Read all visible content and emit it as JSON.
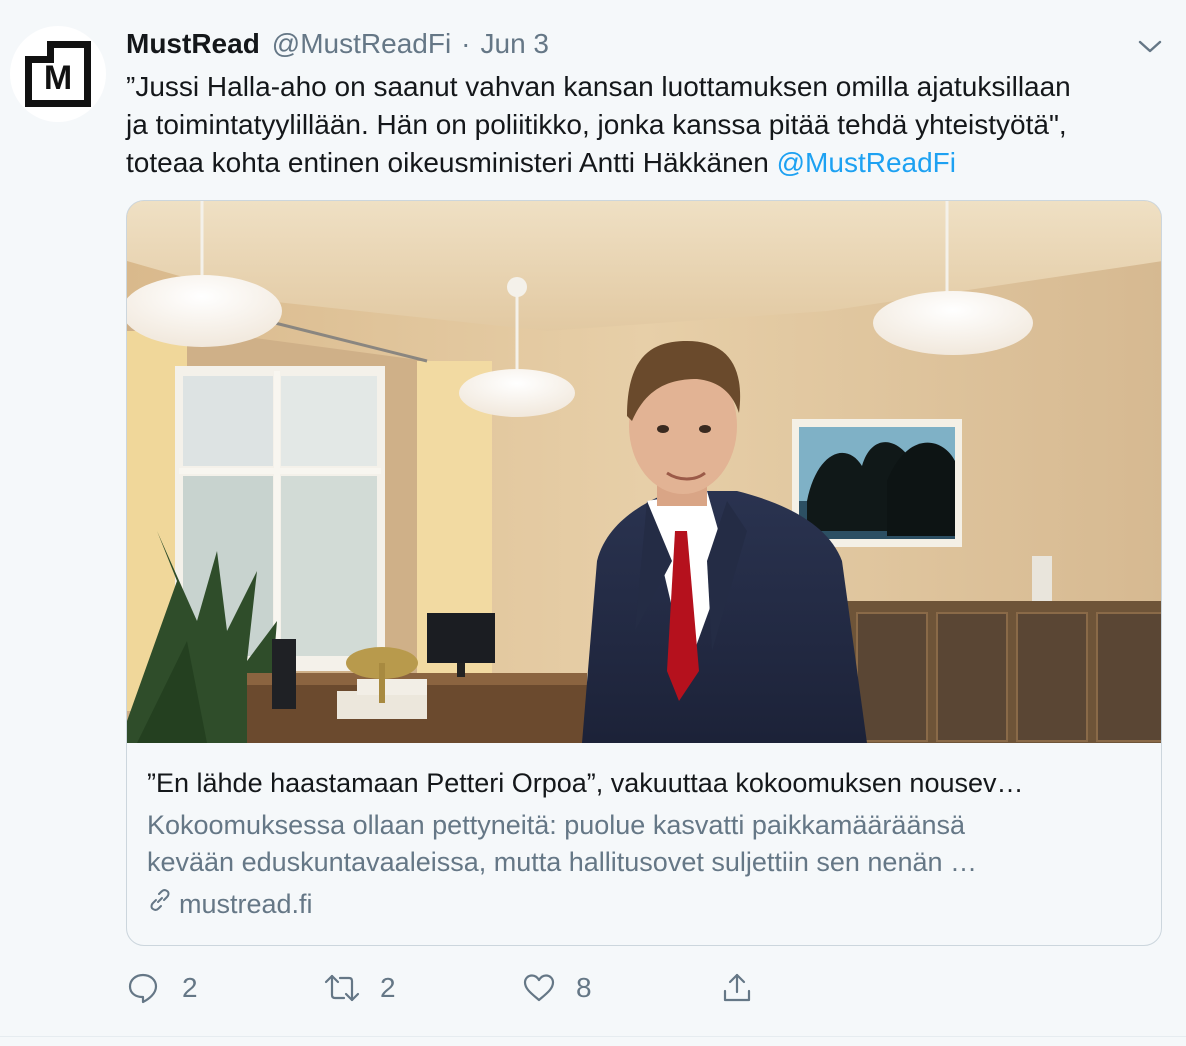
{
  "tweet": {
    "display_name": "MustRead",
    "handle": "@MustReadFi",
    "separator": "·",
    "date": "Jun 3",
    "avatar_letter": "M",
    "text_lines": [
      "”Jussi Halla-aho on saanut vahvan kansan luottamuksen omilla ajatuksillaan",
      "ja toimintatyylillään. Hän on poliitikko, jonka kanssa pitää tehdä yhteistyötä\",",
      "toteaa kohta entinen oikeusministeri Antti Häkkänen "
    ],
    "mention": "@MustReadFi"
  },
  "card": {
    "title": "”En lähde haastamaan Petteri Orpoa”, vakuuttaa kokoomuksen nousev…",
    "description_lines": [
      "Kokoomuksessa ollaan pettyneitä: puolue kasvatti paikkamääräänsä",
      "kevään eduskuntavaaleissa, mutta hallitusovet suljettiin sen nenän …"
    ],
    "domain": "mustread.fi"
  },
  "actions": {
    "reply_count": "2",
    "retweet_count": "2",
    "like_count": "8"
  },
  "colors": {
    "background": "#f5f8fa",
    "text": "#14171a",
    "secondary": "#657786",
    "link": "#1da1f2",
    "border": "#ccd6dd"
  },
  "icons": [
    "chevron-down-icon",
    "link-icon",
    "reply-icon",
    "retweet-icon",
    "like-icon",
    "share-icon"
  ]
}
